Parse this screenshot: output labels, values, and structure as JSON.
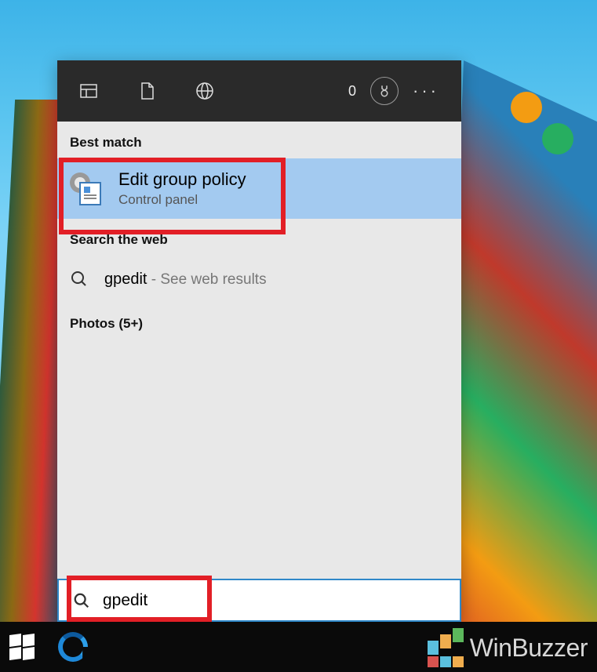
{
  "header": {
    "count": "0"
  },
  "sections": {
    "best_match_label": "Best match",
    "search_web_label": "Search the web",
    "photos_label": "Photos (5+)"
  },
  "best_match": {
    "title": "Edit group policy",
    "subtitle": "Control panel"
  },
  "web_result": {
    "query": "gpedit",
    "suffix": " - See web results"
  },
  "search": {
    "value": "gpedit"
  },
  "watermark": {
    "text": "WinBuzzer"
  }
}
